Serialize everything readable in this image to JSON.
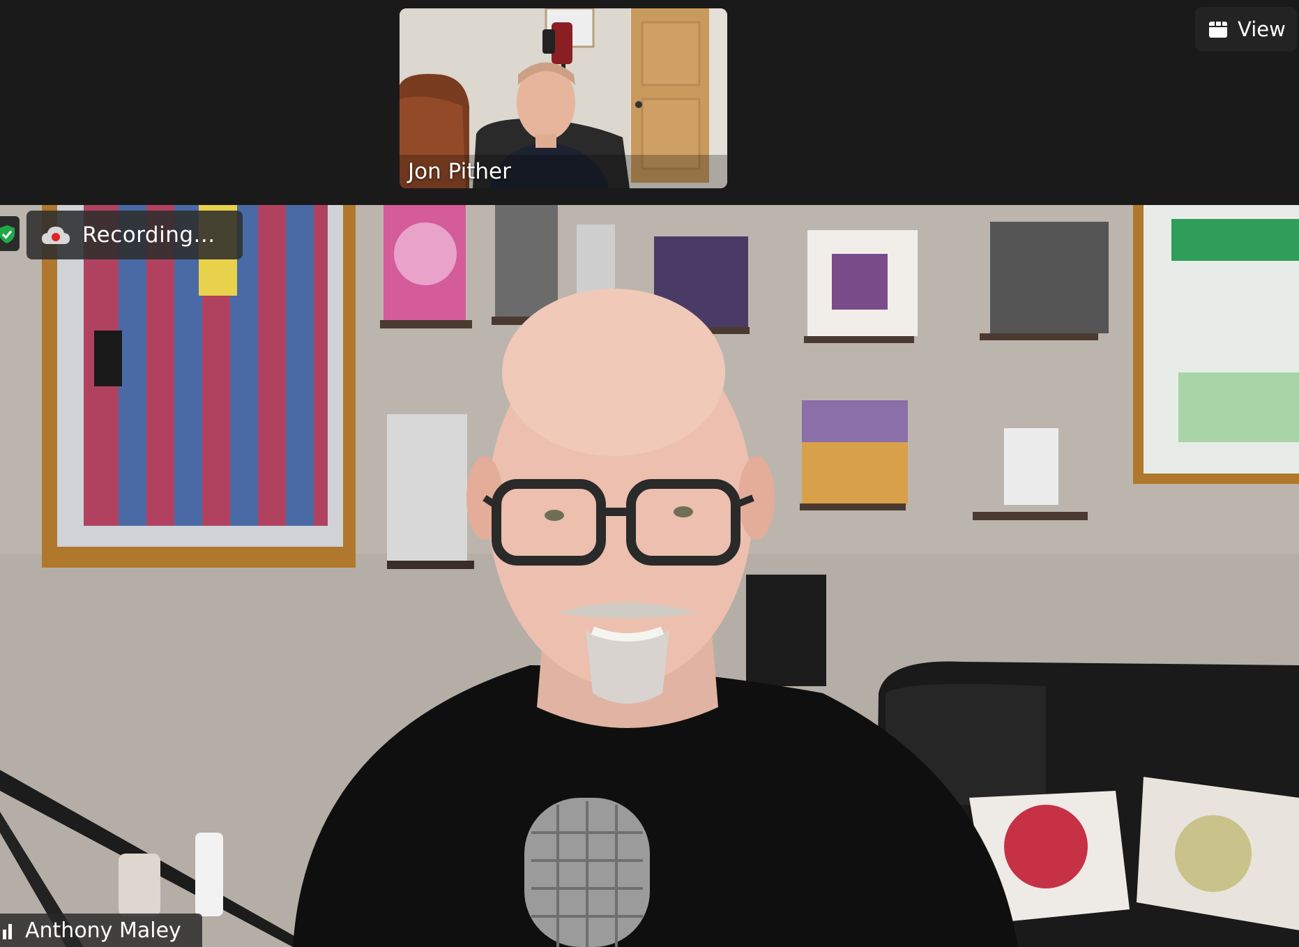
{
  "meeting": {
    "thumbnail_participant": {
      "name": "Jon Pither"
    },
    "active_speaker": {
      "name": "Anthony Maley"
    },
    "recording_status": "Recording...",
    "view_button_label": "View",
    "encryption_icon": "shield-check-icon",
    "recording_icon": "cloud-record-icon"
  },
  "colors": {
    "background": "#1a1a1a",
    "recording_dot": "#e02424",
    "shield_green": "#22a64a"
  }
}
